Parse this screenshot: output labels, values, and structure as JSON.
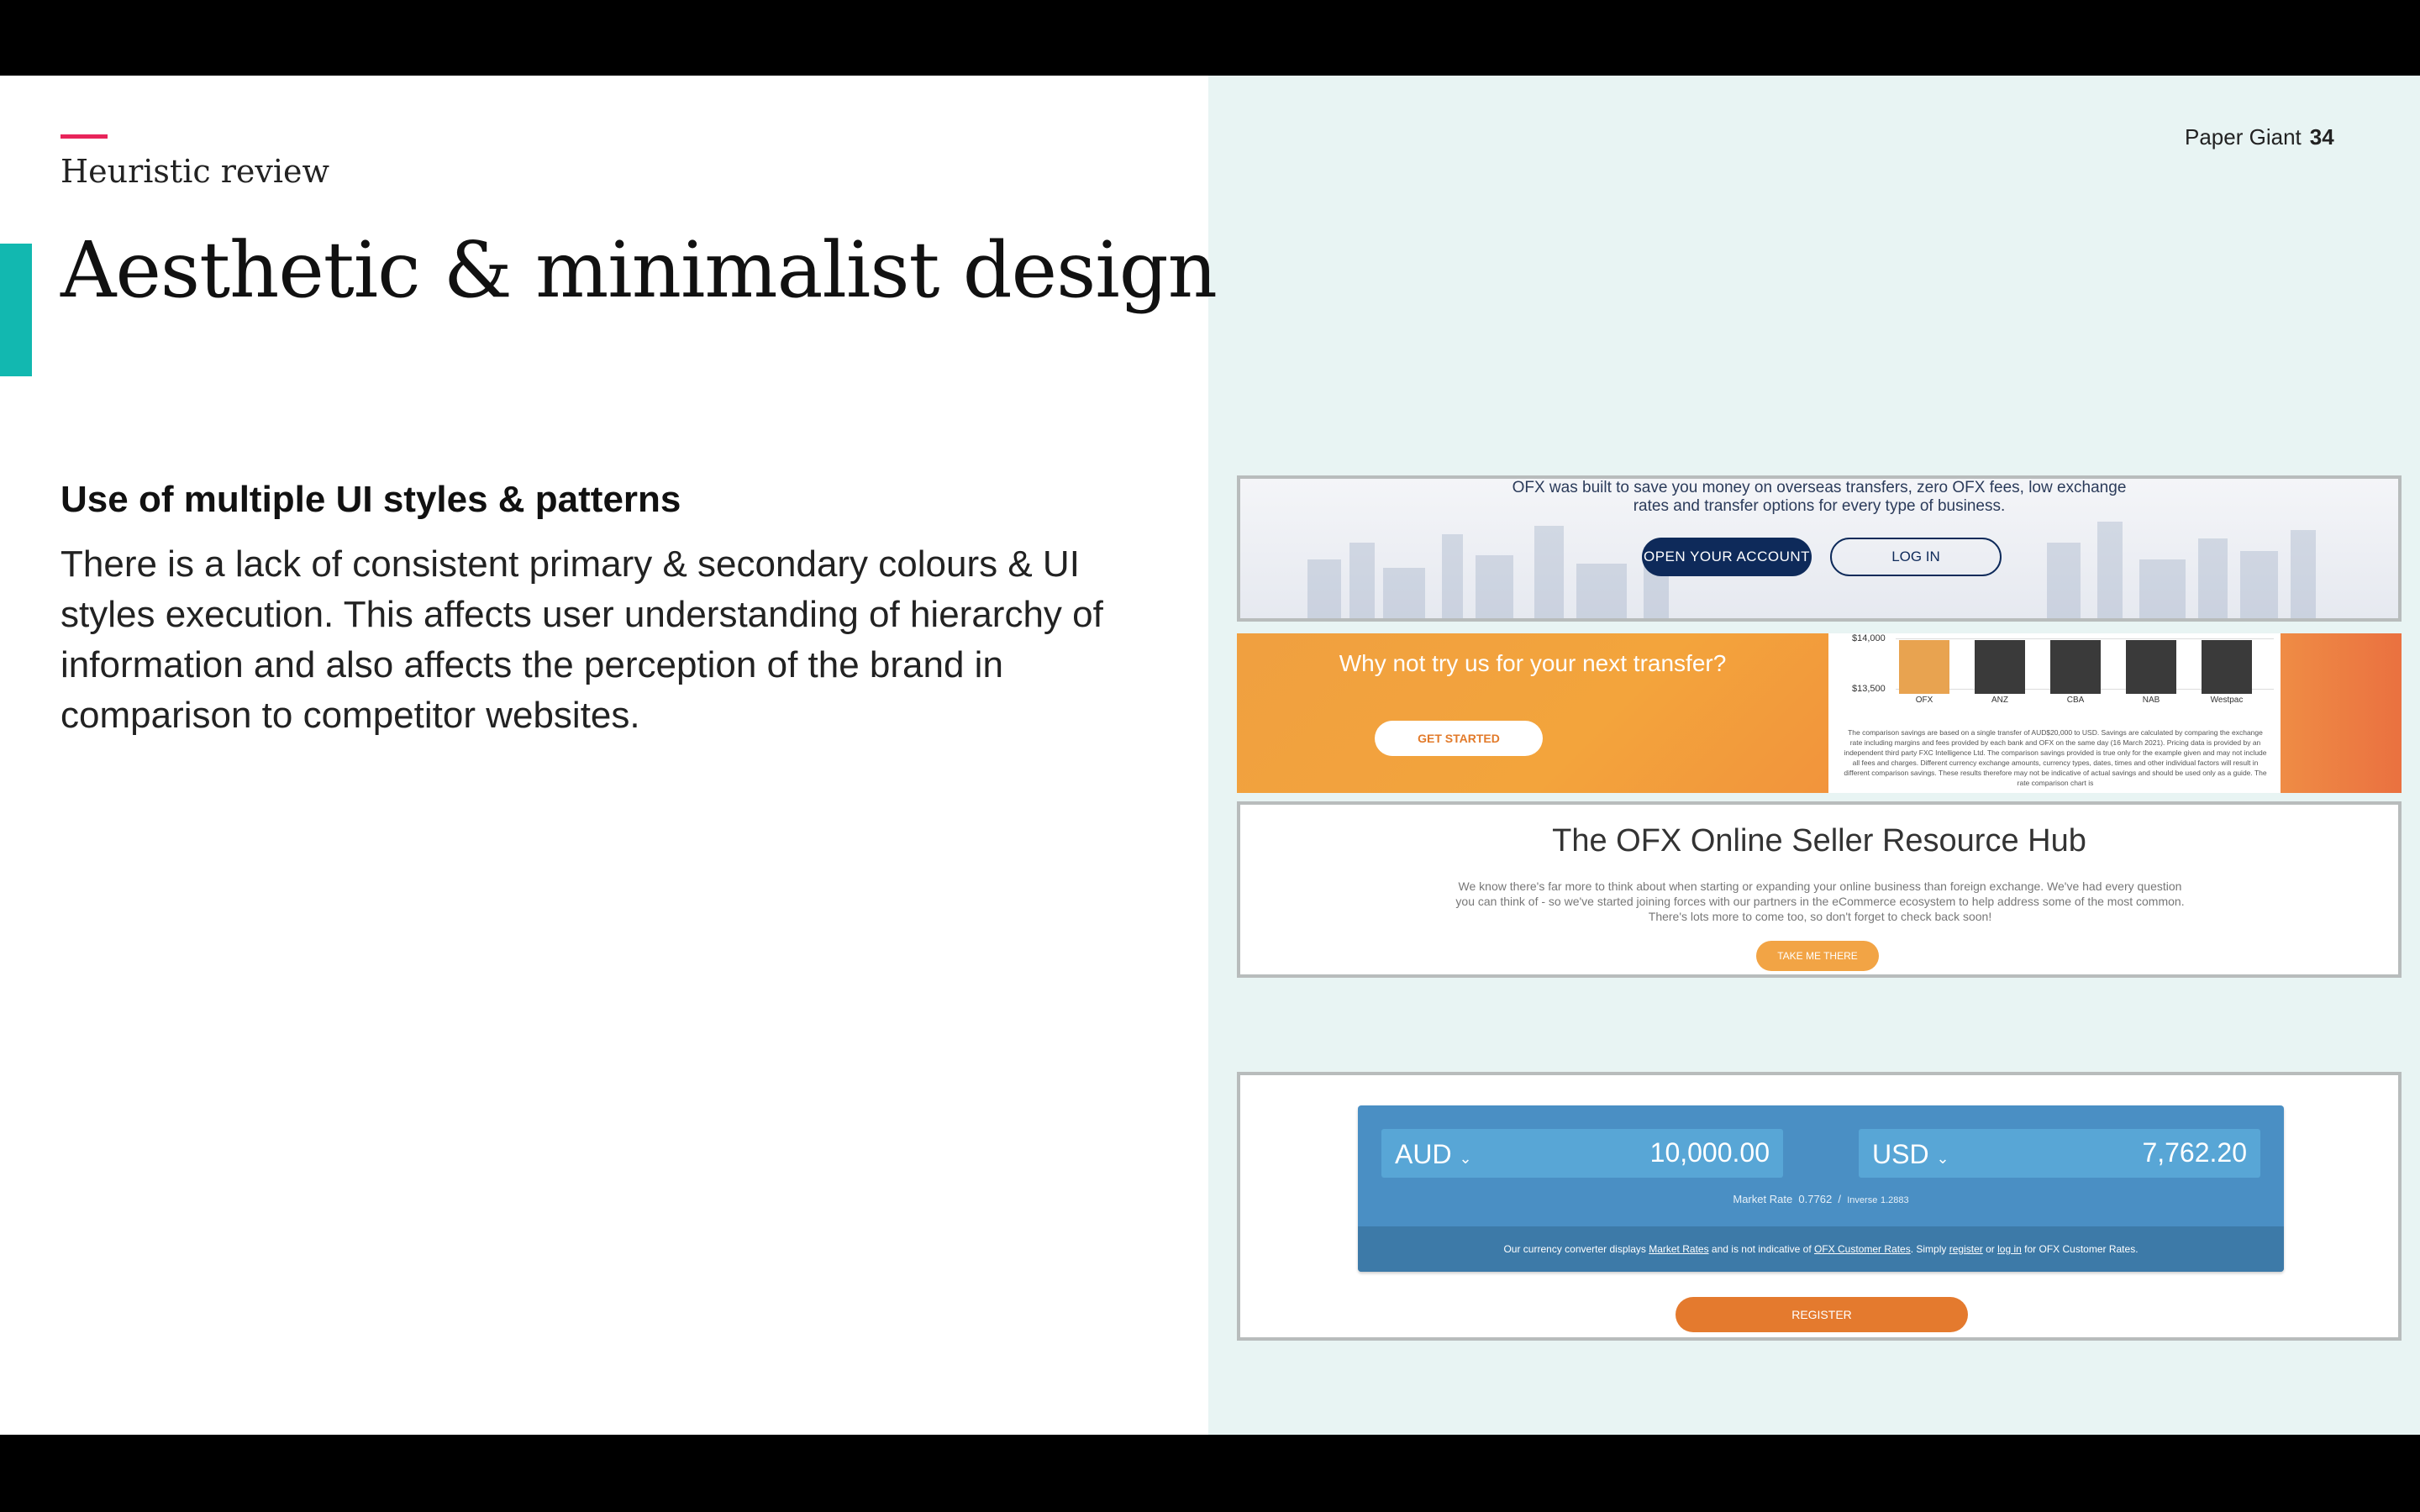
{
  "header": {
    "section_label": "Heuristic review",
    "title": "Aesthetic & minimalist design",
    "brand": "Paper Giant",
    "page_number": "34"
  },
  "content": {
    "subheading": "Use of multiple UI styles & patterns",
    "body": "There is a lack of consistent primary & secondary colours & UI styles execution. This affects user understanding of hierarchy of information and also affects the perception of the brand in comparison to competitor websites."
  },
  "screenshots": {
    "hero": {
      "intro": "OFX was built to save you money on overseas transfers, zero OFX fees, low exchange rates and transfer options for every type of business.",
      "open_account": "OPEN YOUR ACCOUNT",
      "log_in": "LOG IN"
    },
    "promo": {
      "cta": "Why not try us for your next transfer?",
      "get_started": "GET STARTED",
      "chart_ticks": [
        "$14,000",
        "$13,500"
      ],
      "chart_categories": [
        "OFX",
        "ANZ",
        "CBA",
        "NAB",
        "Westpac"
      ],
      "disclaimer": "The comparison savings are based on a single transfer of AUD$20,000 to USD. Savings are calculated by comparing the exchange rate including margins and fees provided by each bank and OFX on the same day (16 March 2021). Pricing data is provided by an independent third party FXC Intelligence Ltd. The comparison savings provided is true only for the example given and may not include all fees and charges. Different currency exchange amounts, currency types, dates, times and other individual factors will result in different comparison savings. These results therefore may not be indicative of actual savings and should be used only as a guide. The rate comparison chart is"
    },
    "hub": {
      "title": "The OFX Online Seller Resource Hub",
      "text": "We know there's far more to think about when starting or expanding your online business than foreign exchange. We've had every question you can think of - so we've started joining forces with our partners in the eCommerce ecosystem to help address some of the most common. There's lots more to come too, so don't forget to check back soon!",
      "take_me_there": "TAKE ME THERE"
    },
    "converter": {
      "from_currency": "AUD",
      "from_amount": "10,000.00",
      "to_currency": "USD",
      "to_amount": "7,762.20",
      "market_rate_label": "Market Rate",
      "market_rate": "0.7762",
      "inverse_label": "Inverse",
      "inverse": "1.2883",
      "footer_pre": "Our currency converter displays",
      "footer_link1": "Market Rates",
      "footer_mid1": "and is not indicative of",
      "footer_link2": "OFX Customer Rates",
      "footer_mid2": ". Simply",
      "footer_link3": "register",
      "footer_mid3": "or",
      "footer_link4": "log in",
      "footer_post": "for OFX Customer Rates.",
      "register": "REGISTER"
    }
  },
  "colors": {
    "accent_pink": "#e8245a",
    "accent_teal": "#12b8b0",
    "panel_bg": "#e8f4f3",
    "ofx_navy": "#0e2a5a",
    "ofx_orange": "#f0a040",
    "ofx_blue": "#4a8fc4"
  }
}
